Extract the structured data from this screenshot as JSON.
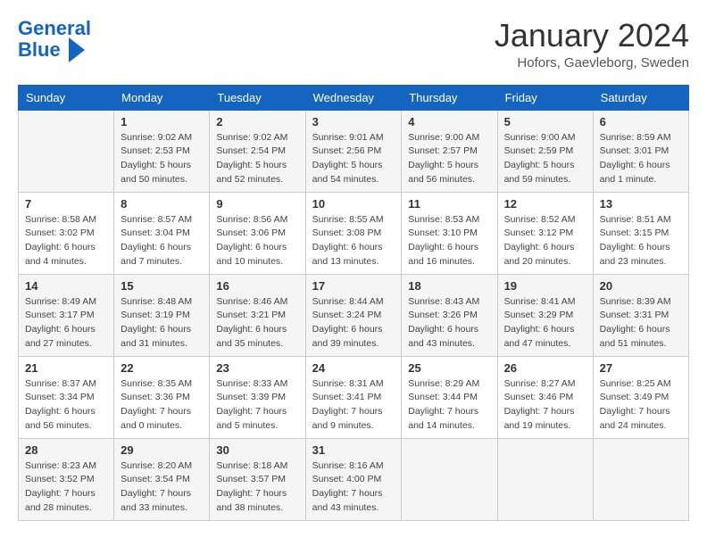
{
  "logo": {
    "line1": "General",
    "line2": "Blue"
  },
  "title": "January 2024",
  "subtitle": "Hofors, Gaevleborg, Sweden",
  "days_of_week": [
    "Sunday",
    "Monday",
    "Tuesday",
    "Wednesday",
    "Thursday",
    "Friday",
    "Saturday"
  ],
  "weeks": [
    [
      {
        "day": "",
        "detail": ""
      },
      {
        "day": "1",
        "detail": "Sunrise: 9:02 AM\nSunset: 2:53 PM\nDaylight: 5 hours\nand 50 minutes."
      },
      {
        "day": "2",
        "detail": "Sunrise: 9:02 AM\nSunset: 2:54 PM\nDaylight: 5 hours\nand 52 minutes."
      },
      {
        "day": "3",
        "detail": "Sunrise: 9:01 AM\nSunset: 2:56 PM\nDaylight: 5 hours\nand 54 minutes."
      },
      {
        "day": "4",
        "detail": "Sunrise: 9:00 AM\nSunset: 2:57 PM\nDaylight: 5 hours\nand 56 minutes."
      },
      {
        "day": "5",
        "detail": "Sunrise: 9:00 AM\nSunset: 2:59 PM\nDaylight: 5 hours\nand 59 minutes."
      },
      {
        "day": "6",
        "detail": "Sunrise: 8:59 AM\nSunset: 3:01 PM\nDaylight: 6 hours\nand 1 minute."
      }
    ],
    [
      {
        "day": "7",
        "detail": "Sunrise: 8:58 AM\nSunset: 3:02 PM\nDaylight: 6 hours\nand 4 minutes."
      },
      {
        "day": "8",
        "detail": "Sunrise: 8:57 AM\nSunset: 3:04 PM\nDaylight: 6 hours\nand 7 minutes."
      },
      {
        "day": "9",
        "detail": "Sunrise: 8:56 AM\nSunset: 3:06 PM\nDaylight: 6 hours\nand 10 minutes."
      },
      {
        "day": "10",
        "detail": "Sunrise: 8:55 AM\nSunset: 3:08 PM\nDaylight: 6 hours\nand 13 minutes."
      },
      {
        "day": "11",
        "detail": "Sunrise: 8:53 AM\nSunset: 3:10 PM\nDaylight: 6 hours\nand 16 minutes."
      },
      {
        "day": "12",
        "detail": "Sunrise: 8:52 AM\nSunset: 3:12 PM\nDaylight: 6 hours\nand 20 minutes."
      },
      {
        "day": "13",
        "detail": "Sunrise: 8:51 AM\nSunset: 3:15 PM\nDaylight: 6 hours\nand 23 minutes."
      }
    ],
    [
      {
        "day": "14",
        "detail": "Sunrise: 8:49 AM\nSunset: 3:17 PM\nDaylight: 6 hours\nand 27 minutes."
      },
      {
        "day": "15",
        "detail": "Sunrise: 8:48 AM\nSunset: 3:19 PM\nDaylight: 6 hours\nand 31 minutes."
      },
      {
        "day": "16",
        "detail": "Sunrise: 8:46 AM\nSunset: 3:21 PM\nDaylight: 6 hours\nand 35 minutes."
      },
      {
        "day": "17",
        "detail": "Sunrise: 8:44 AM\nSunset: 3:24 PM\nDaylight: 6 hours\nand 39 minutes."
      },
      {
        "day": "18",
        "detail": "Sunrise: 8:43 AM\nSunset: 3:26 PM\nDaylight: 6 hours\nand 43 minutes."
      },
      {
        "day": "19",
        "detail": "Sunrise: 8:41 AM\nSunset: 3:29 PM\nDaylight: 6 hours\nand 47 minutes."
      },
      {
        "day": "20",
        "detail": "Sunrise: 8:39 AM\nSunset: 3:31 PM\nDaylight: 6 hours\nand 51 minutes."
      }
    ],
    [
      {
        "day": "21",
        "detail": "Sunrise: 8:37 AM\nSunset: 3:34 PM\nDaylight: 6 hours\nand 56 minutes."
      },
      {
        "day": "22",
        "detail": "Sunrise: 8:35 AM\nSunset: 3:36 PM\nDaylight: 7 hours\nand 0 minutes."
      },
      {
        "day": "23",
        "detail": "Sunrise: 8:33 AM\nSunset: 3:39 PM\nDaylight: 7 hours\nand 5 minutes."
      },
      {
        "day": "24",
        "detail": "Sunrise: 8:31 AM\nSunset: 3:41 PM\nDaylight: 7 hours\nand 9 minutes."
      },
      {
        "day": "25",
        "detail": "Sunrise: 8:29 AM\nSunset: 3:44 PM\nDaylight: 7 hours\nand 14 minutes."
      },
      {
        "day": "26",
        "detail": "Sunrise: 8:27 AM\nSunset: 3:46 PM\nDaylight: 7 hours\nand 19 minutes."
      },
      {
        "day": "27",
        "detail": "Sunrise: 8:25 AM\nSunset: 3:49 PM\nDaylight: 7 hours\nand 24 minutes."
      }
    ],
    [
      {
        "day": "28",
        "detail": "Sunrise: 8:23 AM\nSunset: 3:52 PM\nDaylight: 7 hours\nand 28 minutes."
      },
      {
        "day": "29",
        "detail": "Sunrise: 8:20 AM\nSunset: 3:54 PM\nDaylight: 7 hours\nand 33 minutes."
      },
      {
        "day": "30",
        "detail": "Sunrise: 8:18 AM\nSunset: 3:57 PM\nDaylight: 7 hours\nand 38 minutes."
      },
      {
        "day": "31",
        "detail": "Sunrise: 8:16 AM\nSunset: 4:00 PM\nDaylight: 7 hours\nand 43 minutes."
      },
      {
        "day": "",
        "detail": ""
      },
      {
        "day": "",
        "detail": ""
      },
      {
        "day": "",
        "detail": ""
      }
    ]
  ]
}
